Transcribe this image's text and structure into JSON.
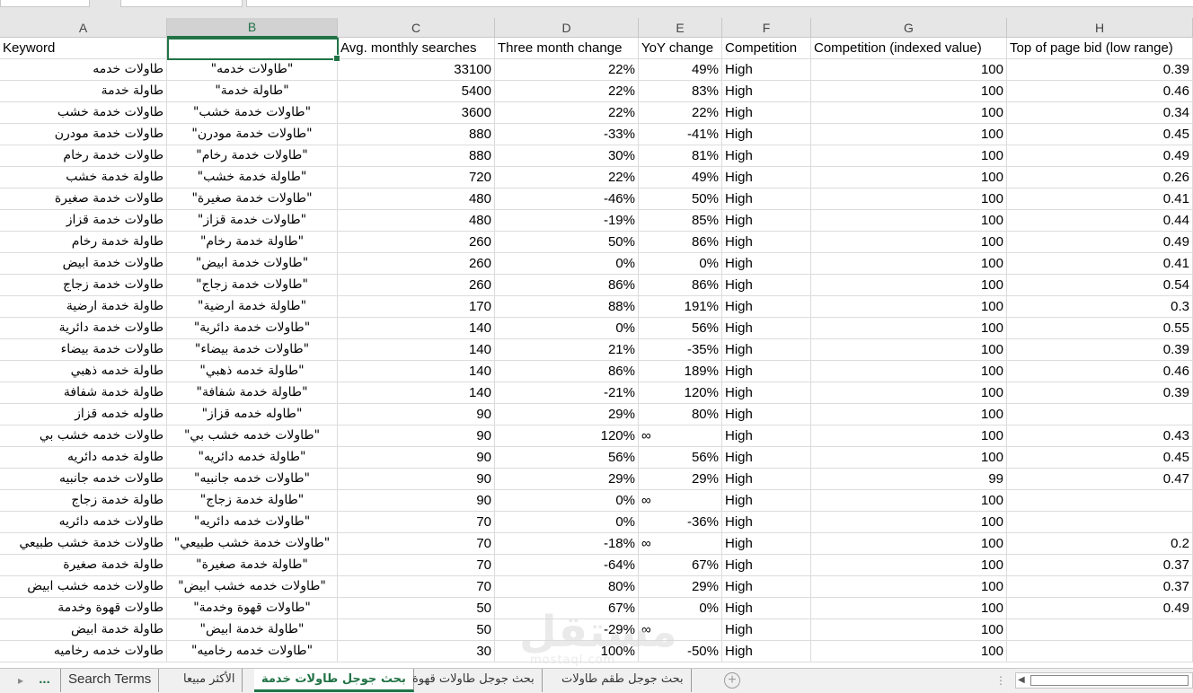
{
  "columns": [
    {
      "letter": "A",
      "header": "Keyword"
    },
    {
      "letter": "B",
      "header": ""
    },
    {
      "letter": "C",
      "header": "Avg. monthly searches"
    },
    {
      "letter": "D",
      "header": "Three month change"
    },
    {
      "letter": "E",
      "header": "YoY change"
    },
    {
      "letter": "F",
      "header": "Competition"
    },
    {
      "letter": "G",
      "header": "Competition (indexed value)"
    },
    {
      "letter": "H",
      "header": "Top of page bid (low range)"
    }
  ],
  "rows": [
    [
      "طاولات خدمه",
      "\"طاولات خدمه\"",
      "33100",
      "22%",
      "49%",
      "High",
      "100",
      "0.39"
    ],
    [
      "طاولة خدمة",
      "\"طاولة خدمة\"",
      "5400",
      "22%",
      "83%",
      "High",
      "100",
      "0.46"
    ],
    [
      "طاولات خدمة خشب",
      "\"طاولات خدمة خشب\"",
      "3600",
      "22%",
      "22%",
      "High",
      "100",
      "0.34"
    ],
    [
      "طاولات خدمة مودرن",
      "\"طاولات خدمة مودرن\"",
      "880",
      "-33%",
      "-41%",
      "High",
      "100",
      "0.45"
    ],
    [
      "طاولات خدمة رخام",
      "\"طاولات خدمة رخام\"",
      "880",
      "30%",
      "81%",
      "High",
      "100",
      "0.49"
    ],
    [
      "طاولة خدمة خشب",
      "\"طاولة خدمة خشب\"",
      "720",
      "22%",
      "49%",
      "High",
      "100",
      "0.26"
    ],
    [
      "طاولات خدمة صغيرة",
      "\"طاولات خدمة صغيرة\"",
      "480",
      "-46%",
      "50%",
      "High",
      "100",
      "0.41"
    ],
    [
      "طاولات خدمة قزاز",
      "\"طاولات خدمة قزاز\"",
      "480",
      "-19%",
      "85%",
      "High",
      "100",
      "0.44"
    ],
    [
      "طاولة خدمة رخام",
      "\"طاولة خدمة رخام\"",
      "260",
      "50%",
      "86%",
      "High",
      "100",
      "0.49"
    ],
    [
      "طاولات خدمة ابيض",
      "\"طاولات خدمة ابيض\"",
      "260",
      "0%",
      "0%",
      "High",
      "100",
      "0.41"
    ],
    [
      "طاولات خدمة زجاج",
      "\"طاولات خدمة زجاج\"",
      "260",
      "86%",
      "86%",
      "High",
      "100",
      "0.54"
    ],
    [
      "طاولة خدمة ارضية",
      "\"طاولة خدمة ارضية\"",
      "170",
      "88%",
      "191%",
      "High",
      "100",
      "0.3"
    ],
    [
      "طاولات خدمة دائرية",
      "\"طاولات خدمة دائرية\"",
      "140",
      "0%",
      "56%",
      "High",
      "100",
      "0.55"
    ],
    [
      "طاولات خدمة بيضاء",
      "\"طاولات خدمة بيضاء\"",
      "140",
      "21%",
      "-35%",
      "High",
      "100",
      "0.39"
    ],
    [
      "طاولة خدمه ذهبي",
      "\"طاولة خدمه ذهبي\"",
      "140",
      "86%",
      "189%",
      "High",
      "100",
      "0.46"
    ],
    [
      "طاولة خدمة شفافة",
      "\"طاولة خدمة شفافة\"",
      "140",
      "-21%",
      "120%",
      "High",
      "100",
      "0.39"
    ],
    [
      "طاوله خدمه قزاز",
      "\"طاوله خدمه قزاز\"",
      "90",
      "29%",
      "80%",
      "High",
      "100",
      ""
    ],
    [
      "طاولات خدمه خشب بي",
      "\"طاولات خدمه خشب بي\"",
      "90",
      "120%",
      "∞",
      "High",
      "100",
      "0.43"
    ],
    [
      "طاولة خدمه دائريه",
      "\"طاولة خدمه دائريه\"",
      "90",
      "56%",
      "56%",
      "High",
      "100",
      "0.45"
    ],
    [
      "طاولات خدمه جانبيه",
      "\"طاولات خدمه جانبيه\"",
      "90",
      "29%",
      "29%",
      "High",
      "99",
      "0.47"
    ],
    [
      "طاولة خدمة زجاج",
      "\"طاولة خدمة زجاج\"",
      "90",
      "0%",
      "∞",
      "High",
      "100",
      ""
    ],
    [
      "طاولات خدمه دائريه",
      "\"طاولات خدمه دائريه\"",
      "70",
      "0%",
      "-36%",
      "High",
      "100",
      ""
    ],
    [
      "طاولات خدمة خشب طبيعي",
      "\"طاولات خدمة خشب طبيعي\"",
      "70",
      "-18%",
      "∞",
      "High",
      "100",
      "0.2"
    ],
    [
      "طاولة خدمة صغيرة",
      "\"طاولة خدمة صغيرة\"",
      "70",
      "-64%",
      "67%",
      "High",
      "100",
      "0.37"
    ],
    [
      "طاولات خدمه خشب ابيض",
      "\"طاولات خدمه خشب ابيض\"",
      "70",
      "80%",
      "29%",
      "High",
      "100",
      "0.37"
    ],
    [
      "طاولات قهوة وخدمة",
      "\"طاولات قهوة وخدمة\"",
      "50",
      "67%",
      "0%",
      "High",
      "100",
      "0.49"
    ],
    [
      "طاولة خدمة ابيض",
      "\"طاولة خدمة ابيض\"",
      "50",
      "-29%",
      "∞",
      "High",
      "100",
      ""
    ],
    [
      "طاولات خدمه رخاميه",
      "\"طاولات خدمه رخاميه\"",
      "30",
      "100%",
      "-50%",
      "High",
      "100",
      ""
    ]
  ],
  "sheet_tabs": {
    "more": "...",
    "tabs": [
      {
        "label": "Search Terms",
        "active": false
      },
      {
        "label": "الأكثر مبيعا",
        "active": false
      },
      {
        "label": "بحث جوجل طاولات خدمة",
        "active": true
      },
      {
        "label": "بحث جوجل طاولات قهوة",
        "active": false
      },
      {
        "label": "بحث جوجل طقم طاولات",
        "active": false
      }
    ],
    "add_label": "+"
  },
  "watermark": {
    "text": "مستقل",
    "sub": "mostaql.com"
  },
  "colors": {
    "accent": "#217346",
    "grid": "#dcdcdc",
    "header_bg": "#e6e6e6"
  }
}
